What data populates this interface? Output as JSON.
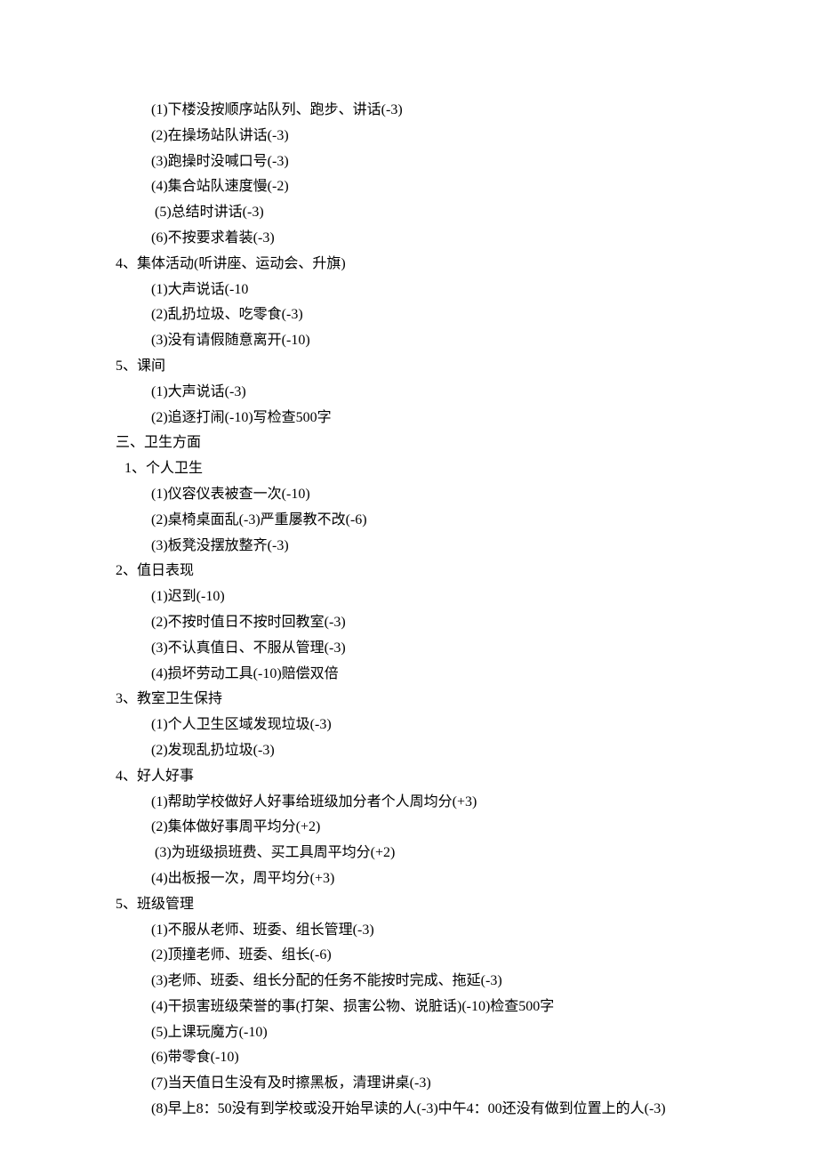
{
  "lines": [
    {
      "cls": "l2",
      "text": "(1)下楼没按顺序站队列、跑步、讲话(-3)"
    },
    {
      "cls": "l2",
      "text": "(2)在操场站队讲话(-3)"
    },
    {
      "cls": "l2",
      "text": "(3)跑操时没喊口号(-3)"
    },
    {
      "cls": "l2",
      "text": "(4)集合站队速度慢(-2)"
    },
    {
      "cls": "l2",
      "text": " (5)总结时讲话(-3)"
    },
    {
      "cls": "l2",
      "text": "(6)不按要求着装(-3)"
    },
    {
      "cls": "l1",
      "text": "4、集体活动(听讲座、运动会、升旗)"
    },
    {
      "cls": "l2",
      "text": "(1)大声说话(-10"
    },
    {
      "cls": "l2",
      "text": "(2)乱扔垃圾、吃零食(-3)"
    },
    {
      "cls": "l2",
      "text": "(3)没有请假随意离开(-10)"
    },
    {
      "cls": "l1",
      "text": "5、课间"
    },
    {
      "cls": "l2",
      "text": "(1)大声说话(-3)"
    },
    {
      "cls": "l2",
      "text": "(2)追逐打闹(-10)写检查500字"
    },
    {
      "cls": "l0",
      "text": "三、卫生方面"
    },
    {
      "cls": "l1b",
      "text": "1、个人卫生"
    },
    {
      "cls": "l2",
      "text": "(1)仪容仪表被查一次(-10)"
    },
    {
      "cls": "l2",
      "text": "(2)桌椅桌面乱(-3)严重屡教不改(-6)"
    },
    {
      "cls": "l2",
      "text": "(3)板凳没摆放整齐(-3)"
    },
    {
      "cls": "l1",
      "text": "2、值日表现"
    },
    {
      "cls": "l2",
      "text": "(1)迟到(-10)"
    },
    {
      "cls": "l2",
      "text": "(2)不按时值日不按时回教室(-3)"
    },
    {
      "cls": "l2",
      "text": "(3)不认真值日、不服从管理(-3)"
    },
    {
      "cls": "l2",
      "text": "(4)损坏劳动工具(-10)赔偿双倍"
    },
    {
      "cls": "l1",
      "text": "3、教室卫生保持"
    },
    {
      "cls": "l2",
      "text": "(1)个人卫生区域发现垃圾(-3)"
    },
    {
      "cls": "l2",
      "text": "(2)发现乱扔垃圾(-3)"
    },
    {
      "cls": "l1",
      "text": "4、好人好事"
    },
    {
      "cls": "l2",
      "text": "(1)帮助学校做好人好事给班级加分者个人周均分(+3)"
    },
    {
      "cls": "l2",
      "text": "(2)集体做好事周平均分(+2)"
    },
    {
      "cls": "l2",
      "text": " (3)为班级损班费、买工具周平均分(+2)"
    },
    {
      "cls": "l2",
      "text": "(4)出板报一次，周平均分(+3)"
    },
    {
      "cls": "l1",
      "text": "5、班级管理"
    },
    {
      "cls": "l2",
      "text": "(1)不服从老师、班委、组长管理(-3)"
    },
    {
      "cls": "l2",
      "text": "(2)顶撞老师、班委、组长(-6)"
    },
    {
      "cls": "l2",
      "text": "(3)老师、班委、组长分配的任务不能按时完成、拖延(-3)"
    },
    {
      "cls": "l2",
      "text": "(4)干损害班级荣誉的事(打架、损害公物、说脏话)(-10)检查500字"
    },
    {
      "cls": "l2",
      "text": "(5)上课玩魔方(-10)"
    },
    {
      "cls": "l2",
      "text": "(6)带零食(-10)"
    },
    {
      "cls": "l2",
      "text": "(7)当天值日生没有及时擦黑板，清理讲桌(-3)"
    },
    {
      "cls": "l2",
      "text": "(8)早上8：50没有到学校或没开始早读的人(-3)中午4：00还没有做到位置上的人(-3)"
    }
  ]
}
